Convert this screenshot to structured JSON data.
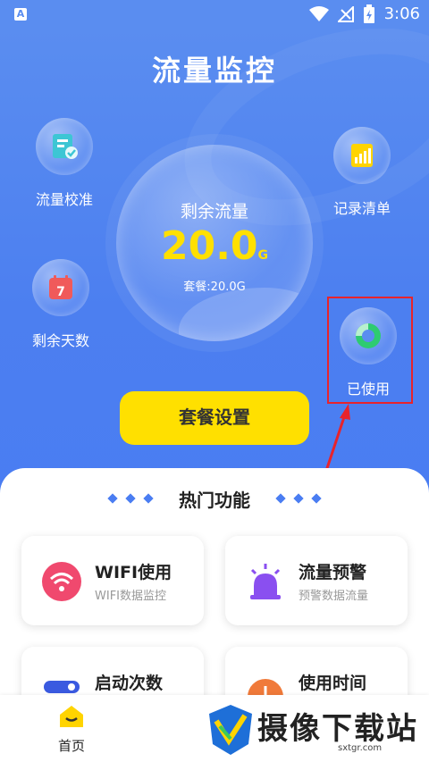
{
  "status_bar": {
    "time": "3:06",
    "app_badge": "A"
  },
  "header": {
    "title": "流量监控",
    "features": {
      "calibrate": "流量校准",
      "days_left": "剩余天数",
      "records": "记录清单",
      "used": "已使用"
    },
    "remaining": {
      "label": "剩余流量",
      "value": "20.0",
      "unit": "G",
      "plan": "套餐:20.0G"
    },
    "plan_button": "套餐设置"
  },
  "hot": {
    "title": "热门功能",
    "items": [
      {
        "title": "WIFI使用",
        "subtitle": "WIFI数据监控"
      },
      {
        "title": "流量预警",
        "subtitle": "预警数据流量"
      },
      {
        "title": "启动次数",
        "subtitle": ""
      },
      {
        "title": "使用时间",
        "subtitle": ""
      }
    ]
  },
  "nav": {
    "home": "首页"
  },
  "watermark": {
    "text": "摄像下载站",
    "url": "sxtgr.com"
  },
  "colors": {
    "primary": "#4a7df2",
    "accent": "#ffe000",
    "highlight": "#e8232b"
  },
  "icons": [
    "wifi-icon",
    "battery-icon",
    "signal-icon",
    "calendar-icon",
    "chart-icon",
    "pie-icon",
    "alarm-icon",
    "clock-icon",
    "home-icon"
  ]
}
